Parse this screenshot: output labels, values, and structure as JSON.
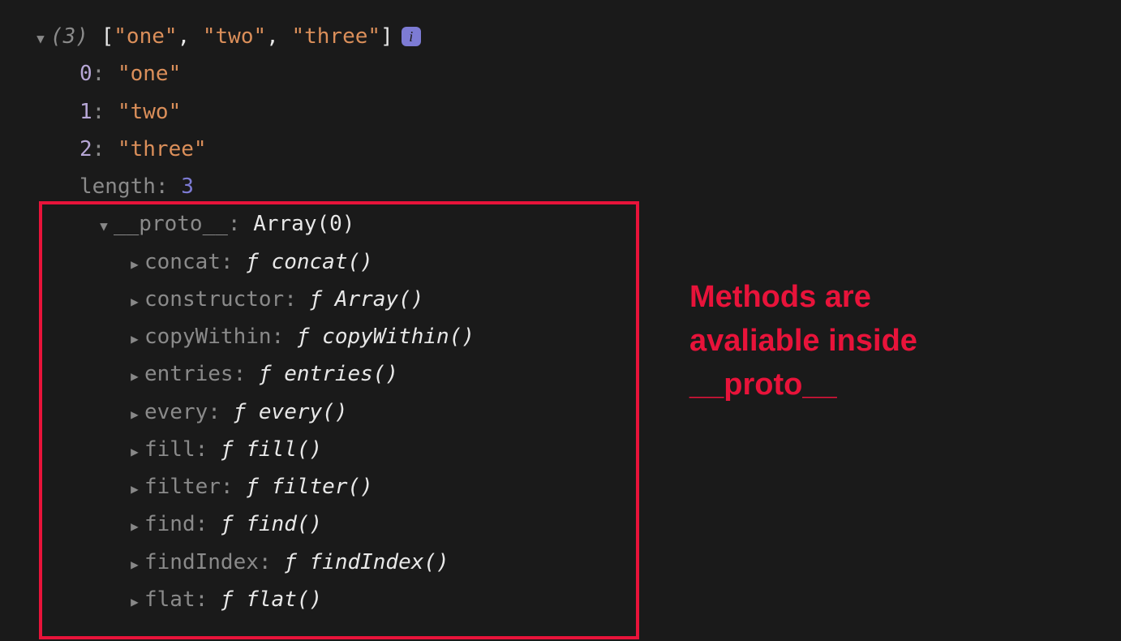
{
  "array": {
    "length_display": "(3)",
    "preview_open": "[",
    "preview_close": "]",
    "preview_sep": ", ",
    "items": [
      {
        "index": "0",
        "value": "\"one\""
      },
      {
        "index": "1",
        "value": "\"two\""
      },
      {
        "index": "2",
        "value": "\"three\""
      }
    ],
    "length_key": "length",
    "length_value": "3"
  },
  "proto": {
    "key": "__proto__",
    "value_type": "Array(0)",
    "methods": [
      {
        "name": "concat",
        "fn": "concat()"
      },
      {
        "name": "constructor",
        "fn": "Array()"
      },
      {
        "name": "copyWithin",
        "fn": "copyWithin()"
      },
      {
        "name": "entries",
        "fn": "entries()"
      },
      {
        "name": "every",
        "fn": "every()"
      },
      {
        "name": "fill",
        "fn": "fill()"
      },
      {
        "name": "filter",
        "fn": "filter()"
      },
      {
        "name": "find",
        "fn": "find()"
      },
      {
        "name": "findIndex",
        "fn": "findIndex()"
      },
      {
        "name": "flat",
        "fn": "flat()"
      }
    ]
  },
  "info_badge": "i",
  "annotation": "Methods are\navaliable inside\n__proto__",
  "colon": ": ",
  "f_glyph": "ƒ "
}
